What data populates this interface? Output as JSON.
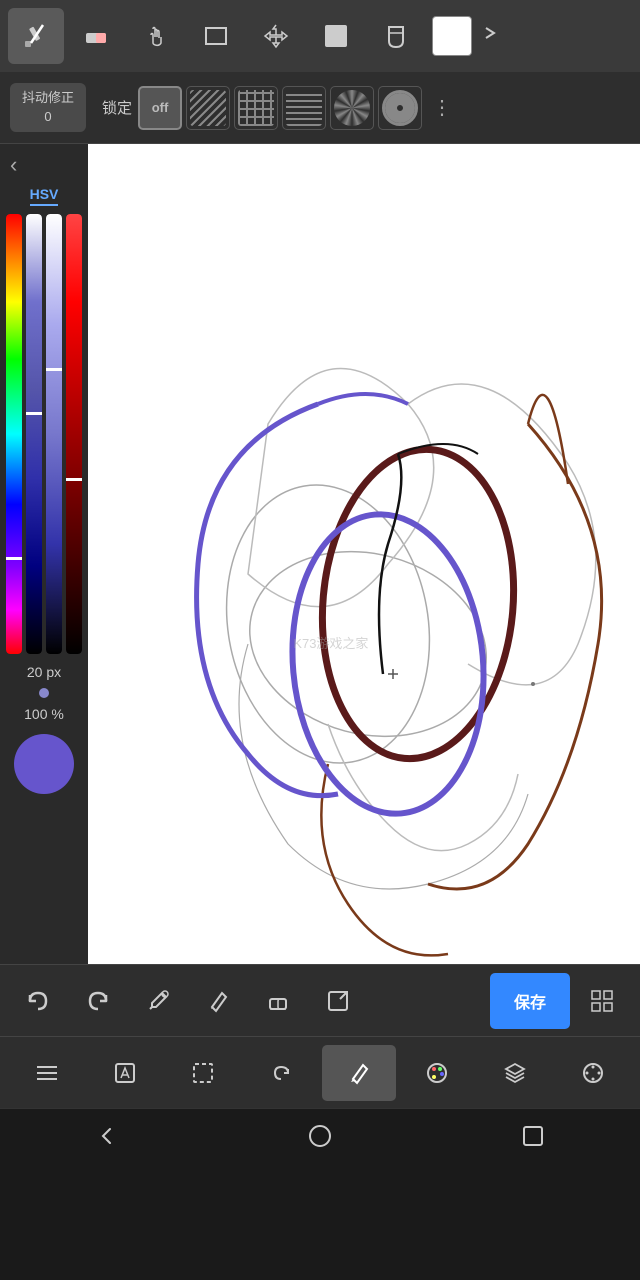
{
  "topToolbar": {
    "tools": [
      {
        "name": "pencil",
        "label": "✏",
        "active": true
      },
      {
        "name": "eraser",
        "label": "◻",
        "active": false
      },
      {
        "name": "hand",
        "label": "✋",
        "active": false
      },
      {
        "name": "rectangle",
        "label": "□",
        "active": false
      },
      {
        "name": "move",
        "label": "✥",
        "active": false
      },
      {
        "name": "fill",
        "label": "◼",
        "active": false
      },
      {
        "name": "bucket",
        "label": "⬡",
        "active": false
      }
    ],
    "expand_label": "❯",
    "color_swatch_label": ""
  },
  "secondToolbar": {
    "shake_label": "抖动修正",
    "shake_value": "0",
    "lock_label": "锁定",
    "lock_options": [
      {
        "name": "off",
        "label": "off",
        "active": true
      },
      {
        "name": "diag-hatch",
        "label": "diag",
        "active": false
      },
      {
        "name": "grid",
        "label": "grid",
        "active": false
      },
      {
        "name": "horiz",
        "label": "horiz",
        "active": false
      },
      {
        "name": "rays",
        "label": "rays",
        "active": false
      },
      {
        "name": "circles",
        "label": "circles",
        "active": false
      }
    ],
    "more_label": "⋮"
  },
  "leftPanel": {
    "back_label": "‹",
    "hsv_label": "HSV",
    "size_label": "20 px",
    "opacity_label": "100 %"
  },
  "watermark": {
    "text": "K73游戏之家"
  },
  "bottomToolbar1": {
    "buttons": [
      {
        "name": "undo",
        "label": "↩"
      },
      {
        "name": "redo",
        "label": "↪"
      },
      {
        "name": "eyedropper",
        "label": "💉"
      },
      {
        "name": "brush-tool",
        "label": "✏"
      },
      {
        "name": "eraser-tool",
        "label": "⬡"
      },
      {
        "name": "export",
        "label": "⬡"
      }
    ],
    "save_label": "保存",
    "grid_label": "⊞"
  },
  "bottomToolbar2": {
    "buttons": [
      {
        "name": "menu",
        "label": "☰",
        "active": false
      },
      {
        "name": "edit",
        "label": "✎",
        "active": false
      },
      {
        "name": "select",
        "label": "⬚",
        "active": false
      },
      {
        "name": "rotate",
        "label": "↻",
        "active": false
      },
      {
        "name": "pen",
        "label": "✒",
        "active": true
      },
      {
        "name": "palette",
        "label": "🎨",
        "active": false
      },
      {
        "name": "layers",
        "label": "⬡",
        "active": false
      },
      {
        "name": "settings",
        "label": "⊙",
        "active": false
      }
    ]
  },
  "navBar": {
    "back_label": "◁",
    "home_label": "○",
    "recent_label": "□"
  }
}
